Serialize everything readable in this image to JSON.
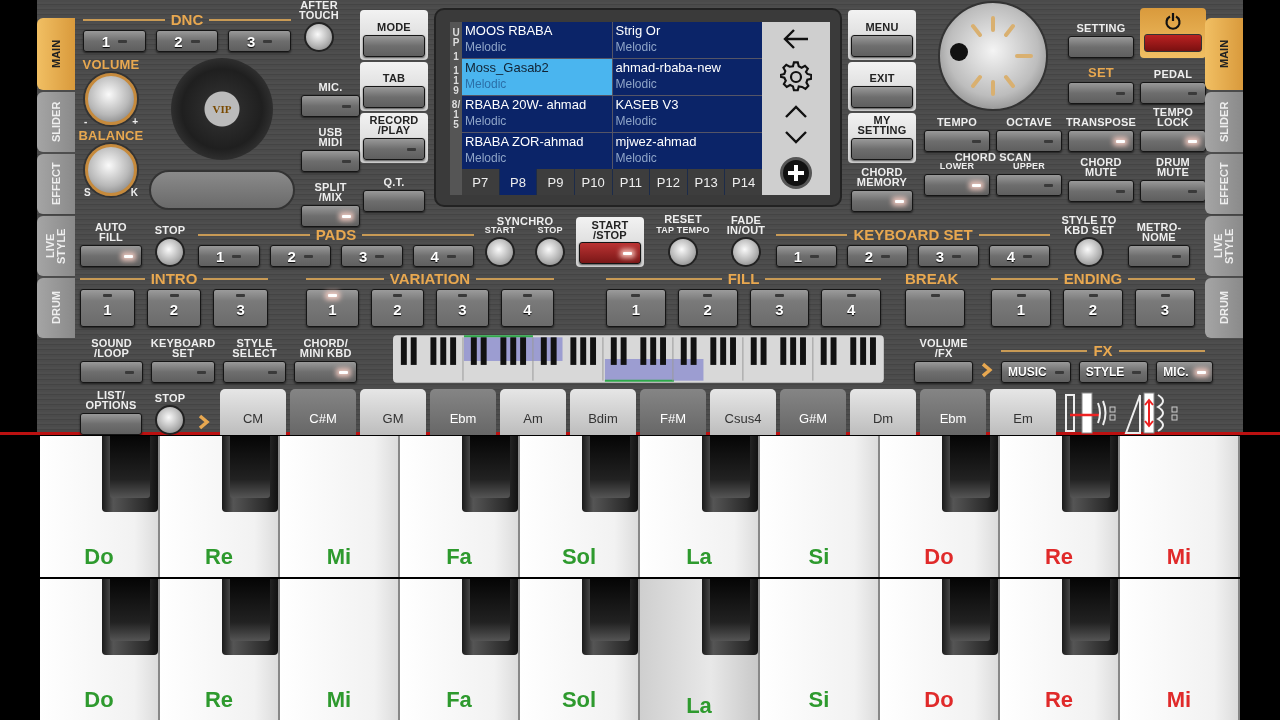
{
  "side_tabs_left": [
    {
      "label": "MAIN",
      "selected": true
    },
    {
      "label": "SLIDER",
      "selected": false
    },
    {
      "label": "EFFECT",
      "selected": false
    },
    {
      "label": "LIVE\nSTYLE",
      "selected": false
    },
    {
      "label": "DRUM",
      "selected": false
    }
  ],
  "side_tabs_right": [
    {
      "label": "MAIN",
      "selected": true
    },
    {
      "label": "SLIDER",
      "selected": false
    },
    {
      "label": "EFFECT",
      "selected": false
    },
    {
      "label": "LIVE\nSTYLE",
      "selected": false
    },
    {
      "label": "DRUM",
      "selected": false
    }
  ],
  "dnc": {
    "title": "DNC",
    "buttons": [
      {
        "label": "1",
        "lit": false
      },
      {
        "label": "2",
        "lit": false
      },
      {
        "label": "3",
        "lit": false
      }
    ]
  },
  "after_touch": {
    "label": "AFTER\nTOUCH"
  },
  "volume": {
    "label": "VOLUME",
    "min": "-",
    "max": "+"
  },
  "balance": {
    "label": "BALANCE",
    "min": "S",
    "max": "K"
  },
  "platter_logo": "VIP",
  "left_buttons": [
    {
      "label": "MIC.",
      "lit": false
    },
    {
      "label": "USB\nMIDI",
      "lit": false
    },
    {
      "label": "SPLIT\n/MIX",
      "lit": true
    }
  ],
  "mode_column": [
    {
      "label": "MODE",
      "kind": "panel"
    },
    {
      "label": "TAB",
      "kind": "panel"
    },
    {
      "label": "RECORD\n/PLAY",
      "kind": "panel",
      "lit": false
    },
    {
      "label": "Q.T.",
      "kind": "plain"
    }
  ],
  "screen": {
    "side_label": [
      "UP",
      "1",
      "119",
      "8/15"
    ],
    "sounds": [
      {
        "name": "MOOS RBABA",
        "category": "Melodic",
        "selected": false
      },
      {
        "name": "Strig Or",
        "category": "Melodic",
        "selected": false
      },
      {
        "name": "Moss_Gasab2",
        "category": "Melodic",
        "selected": true
      },
      {
        "name": "ahmad-rbaba-new",
        "category": "Melodic",
        "selected": false
      },
      {
        "name": "RBABA 20W- ahmad",
        "category": "Melodic",
        "selected": false
      },
      {
        "name": "KASEB V3",
        "category": "Melodic",
        "selected": false
      },
      {
        "name": "RBABA ZOR-ahmad",
        "category": "Melodic",
        "selected": false
      },
      {
        "name": "mjwez-ahmad",
        "category": "Melodic",
        "selected": false
      }
    ],
    "pages": [
      {
        "label": "P7",
        "selected": false
      },
      {
        "label": "P8",
        "selected": true
      },
      {
        "label": "P9",
        "selected": false
      },
      {
        "label": "P10",
        "selected": false
      },
      {
        "label": "P11",
        "selected": false
      },
      {
        "label": "P12",
        "selected": false
      },
      {
        "label": "P13",
        "selected": false
      },
      {
        "label": "P14",
        "selected": false
      }
    ]
  },
  "menu_column": [
    {
      "label": "MENU",
      "kind": "panel"
    },
    {
      "label": "EXIT",
      "kind": "panel"
    },
    {
      "label": "MY\nSETTING",
      "kind": "panel"
    },
    {
      "label": "CHORD\nMEMORY",
      "kind": "plain",
      "lit": true
    }
  ],
  "setting": {
    "label": "SETTING"
  },
  "set_row": [
    {
      "label": "SET",
      "kind": "accent",
      "lit": false
    },
    {
      "label": "PEDAL",
      "kind": "plain",
      "lit": false
    }
  ],
  "tempo_row": [
    {
      "label": "TEMPO",
      "lit": false
    },
    {
      "label": "OCTAVE",
      "lit": false
    },
    {
      "label": "TRANSPOSE",
      "lit": true
    },
    {
      "label": "TEMPO\nLOCK",
      "lit": true
    }
  ],
  "chord_scan": {
    "title": "CHORD SCAN",
    "buttons": [
      {
        "label": "LOWER",
        "lit": true
      },
      {
        "label": "UPPER",
        "lit": false
      }
    ]
  },
  "mute_row": [
    {
      "label": "CHORD\nMUTE",
      "lit": false
    },
    {
      "label": "DRUM\nMUTE",
      "lit": false
    }
  ],
  "auto_fill": {
    "label": "AUTO\nFILL",
    "lit": true
  },
  "stop_top": {
    "label": "STOP"
  },
  "pads": {
    "title": "PADS",
    "buttons": [
      {
        "label": "1",
        "lit": false
      },
      {
        "label": "2",
        "lit": false
      },
      {
        "label": "3",
        "lit": false
      },
      {
        "label": "4",
        "lit": false
      }
    ]
  },
  "synchro": {
    "title": "SYNCHRO",
    "knobs": [
      "START",
      "STOP"
    ]
  },
  "start_stop": {
    "label": "START\n/STOP",
    "lit": true
  },
  "reset": {
    "label": "RESET",
    "sublabel": "TAP TEMPO"
  },
  "fade": {
    "label": "FADE\nIN/OUT"
  },
  "keyboard_set": {
    "title": "KEYBOARD SET",
    "buttons": [
      {
        "label": "1",
        "lit": false
      },
      {
        "label": "2",
        "lit": false
      },
      {
        "label": "3",
        "lit": false
      },
      {
        "label": "4",
        "lit": false
      }
    ]
  },
  "style_to_kbd": {
    "label": "STYLE TO\nKBD SET"
  },
  "metronome": {
    "label": "METRO-\nNOME",
    "lit": false
  },
  "intro": {
    "title": "INTRO",
    "buttons": [
      {
        "label": "1",
        "lit": false
      },
      {
        "label": "2",
        "lit": false
      },
      {
        "label": "3",
        "lit": false
      }
    ]
  },
  "variation": {
    "title": "VARIATION",
    "buttons": [
      {
        "label": "1",
        "lit": true
      },
      {
        "label": "2",
        "lit": false
      },
      {
        "label": "3",
        "lit": false
      },
      {
        "label": "4",
        "lit": false
      }
    ]
  },
  "fill": {
    "title": "FILL",
    "buttons": [
      {
        "label": "1",
        "lit": false
      },
      {
        "label": "2",
        "lit": false
      },
      {
        "label": "3",
        "lit": false
      },
      {
        "label": "4",
        "lit": false
      }
    ]
  },
  "break": {
    "title": "BREAK",
    "buttons": [
      {
        "lit": false
      }
    ]
  },
  "ending": {
    "title": "ENDING",
    "buttons": [
      {
        "label": "1",
        "lit": false
      },
      {
        "label": "2",
        "lit": false
      },
      {
        "label": "3",
        "lit": false
      }
    ]
  },
  "style_buttons": [
    {
      "label": "SOUND\n/LOOP",
      "lit": false
    },
    {
      "label": "KEYBOARD\nSET",
      "lit": false
    },
    {
      "label": "STYLE\nSELECT",
      "lit": false
    },
    {
      "label": "CHORD/\nMINI KBD",
      "lit": true
    }
  ],
  "volume_fx": {
    "label": "VOLUME\n/FX"
  },
  "fx": {
    "title": "FX",
    "buttons": [
      {
        "label": "MUSIC",
        "lit": false
      },
      {
        "label": "STYLE",
        "lit": false
      },
      {
        "label": "MIC.",
        "lit": true
      }
    ]
  },
  "list_options": {
    "label": "LIST/\nOPTIONS"
  },
  "stop_bottom": {
    "label": "STOP"
  },
  "chords": [
    {
      "label": "CM",
      "kind": "light"
    },
    {
      "label": "C#M",
      "kind": "dark"
    },
    {
      "label": "GM",
      "kind": "light"
    },
    {
      "label": "Ebm",
      "kind": "dark"
    },
    {
      "label": "Am",
      "kind": "light"
    },
    {
      "label": "Bdim",
      "kind": "light"
    },
    {
      "label": "F#M",
      "kind": "dark"
    },
    {
      "label": "Csus4",
      "kind": "light"
    },
    {
      "label": "G#M",
      "kind": "dark"
    },
    {
      "label": "Dm",
      "kind": "light"
    },
    {
      "label": "Ebm",
      "kind": "dark"
    },
    {
      "label": "Em",
      "kind": "light"
    }
  ],
  "keyboard": [
    {
      "keys": [
        {
          "label": "Do",
          "color": "#2e9a2e",
          "sharp": true,
          "pressed": false
        },
        {
          "label": "Re",
          "color": "#2e9a2e",
          "sharp": true,
          "pressed": false
        },
        {
          "label": "Mi",
          "color": "#2e9a2e",
          "sharp": false,
          "pressed": false
        },
        {
          "label": "Fa",
          "color": "#2e9a2e",
          "sharp": true,
          "pressed": false
        },
        {
          "label": "Sol",
          "color": "#2e9a2e",
          "sharp": true,
          "pressed": false
        },
        {
          "label": "La",
          "color": "#2e9a2e",
          "sharp": true,
          "pressed": false
        },
        {
          "label": "Si",
          "color": "#2e9a2e",
          "sharp": false,
          "pressed": false
        },
        {
          "label": "Do",
          "color": "#e02a2a",
          "sharp": true,
          "pressed": false
        },
        {
          "label": "Re",
          "color": "#e02a2a",
          "sharp": true,
          "pressed": false
        },
        {
          "label": "Mi",
          "color": "#e02a2a",
          "sharp": false,
          "pressed": false
        }
      ]
    },
    {
      "keys": [
        {
          "label": "Do",
          "color": "#2e9a2e",
          "sharp": true,
          "pressed": false
        },
        {
          "label": "Re",
          "color": "#2e9a2e",
          "sharp": true,
          "pressed": false
        },
        {
          "label": "Mi",
          "color": "#2e9a2e",
          "sharp": false,
          "pressed": false
        },
        {
          "label": "Fa",
          "color": "#2e9a2e",
          "sharp": true,
          "pressed": false
        },
        {
          "label": "Sol",
          "color": "#2e9a2e",
          "sharp": true,
          "pressed": false
        },
        {
          "label": "La",
          "color": "#2e9a2e",
          "sharp": true,
          "pressed": true
        },
        {
          "label": "Si",
          "color": "#2e9a2e",
          "sharp": false,
          "pressed": false
        },
        {
          "label": "Do",
          "color": "#e02a2a",
          "sharp": true,
          "pressed": false
        },
        {
          "label": "Re",
          "color": "#e02a2a",
          "sharp": true,
          "pressed": false
        },
        {
          "label": "Mi",
          "color": "#e02a2a",
          "sharp": false,
          "pressed": false
        }
      ]
    }
  ]
}
